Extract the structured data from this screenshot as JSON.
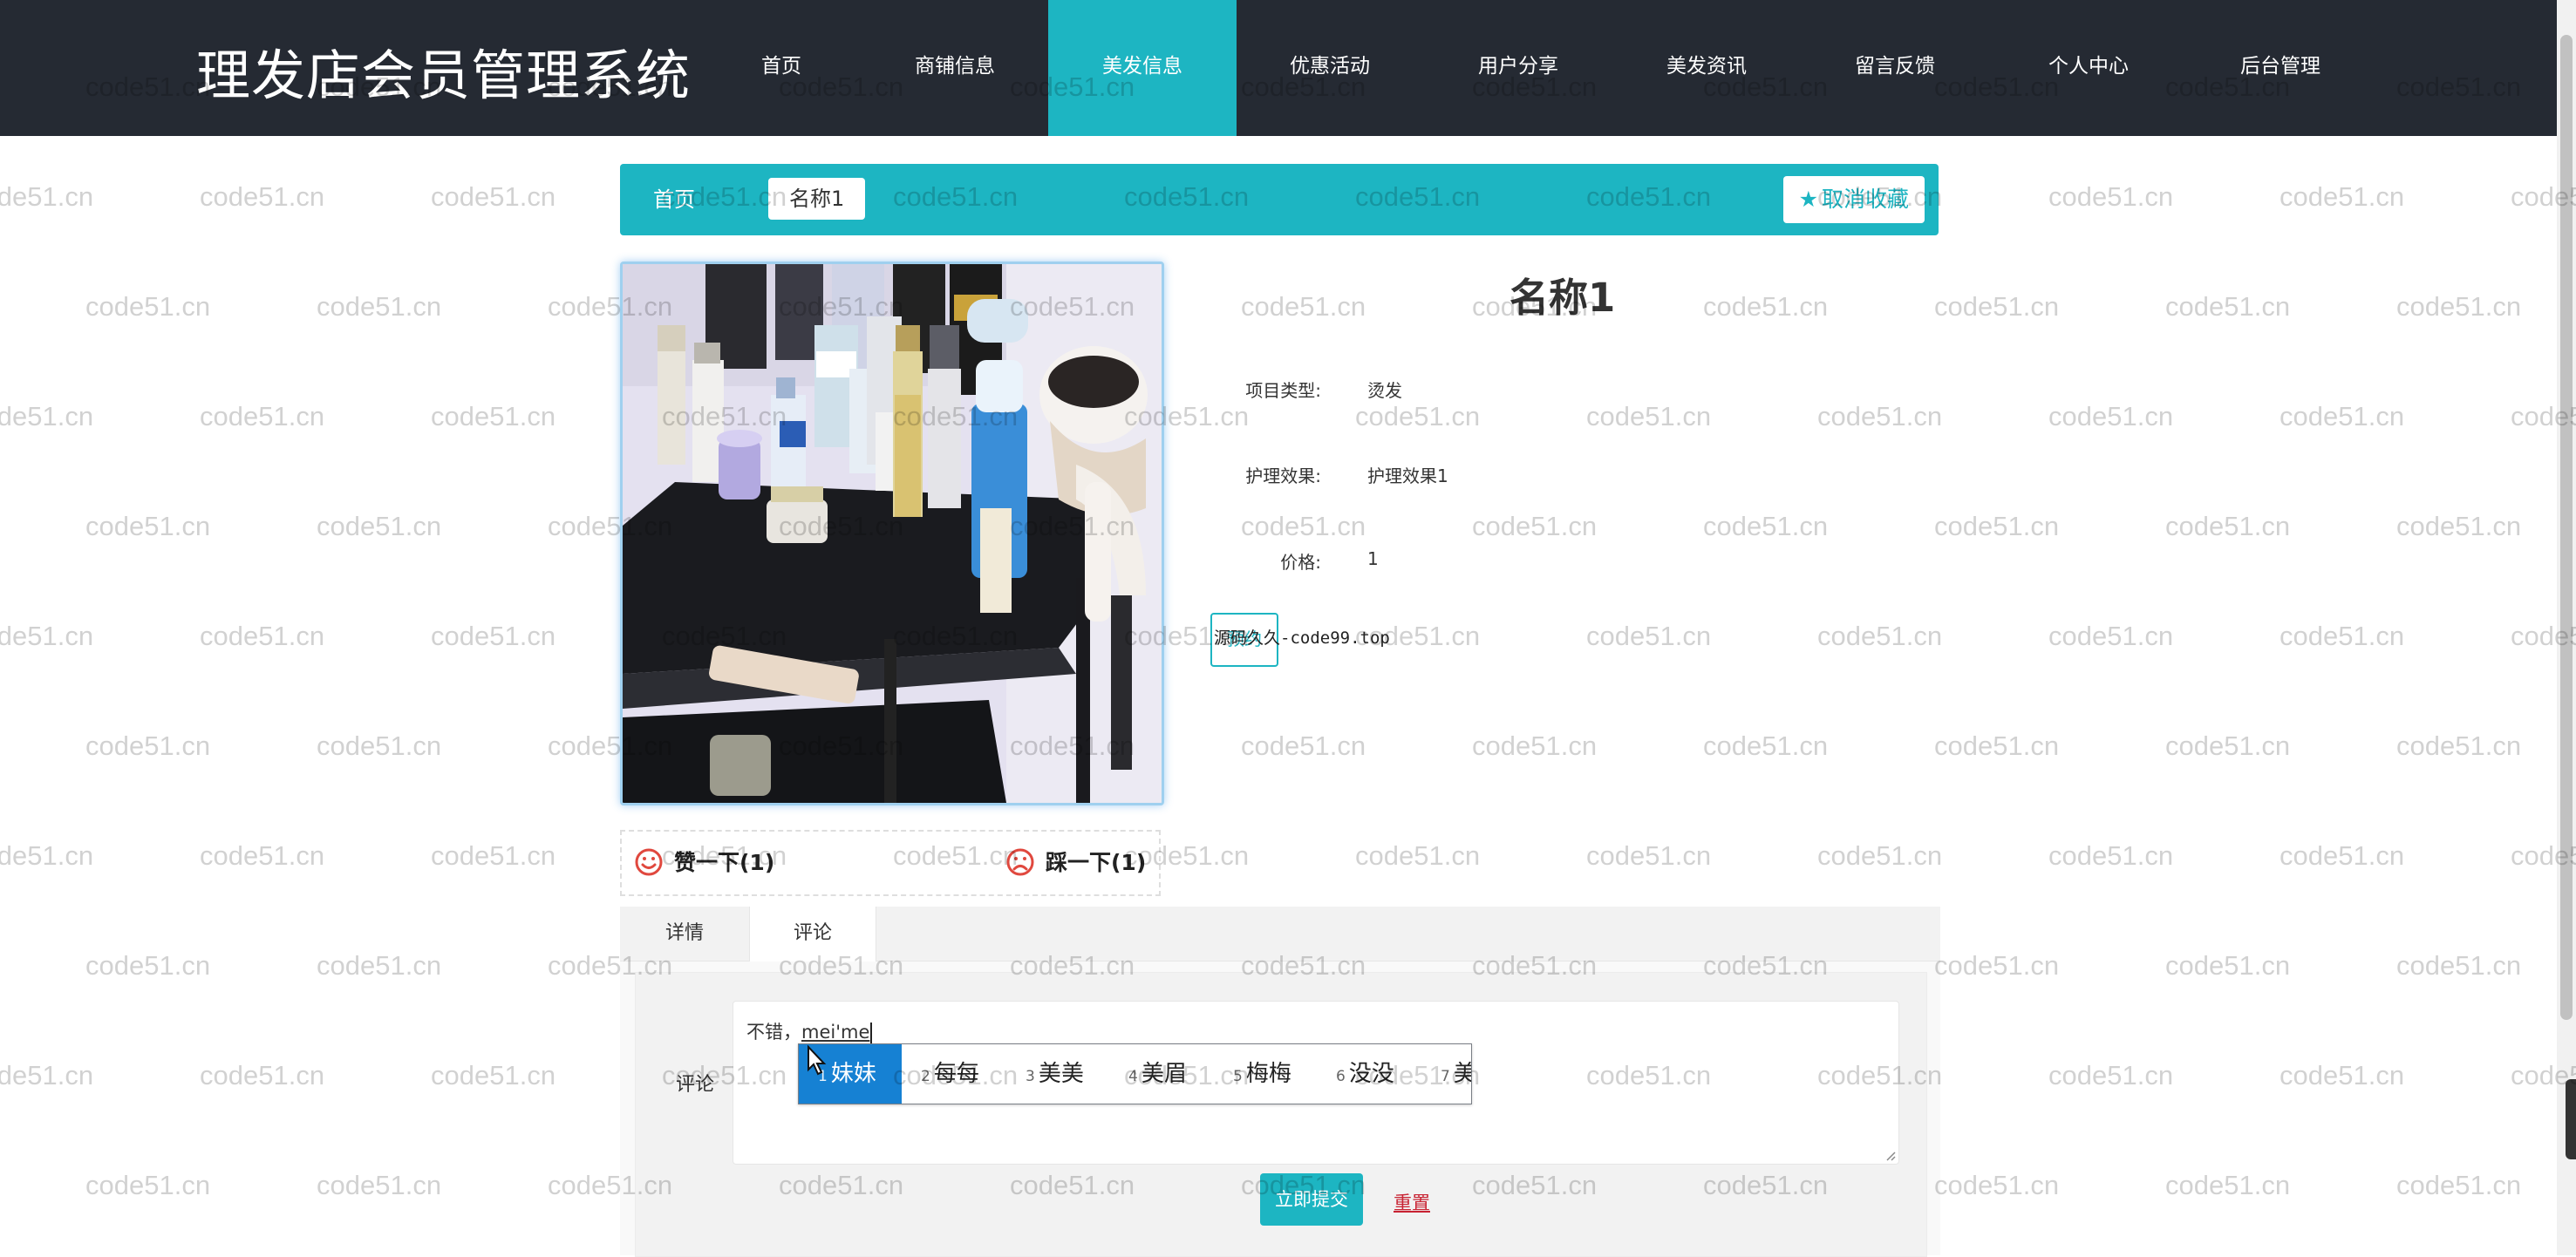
{
  "header": {
    "site_title": "理发店会员管理系统",
    "nav": [
      {
        "label": "首页",
        "active": false
      },
      {
        "label": "商铺信息",
        "active": false
      },
      {
        "label": "美发信息",
        "active": true
      },
      {
        "label": "优惠活动",
        "active": false
      },
      {
        "label": "用户分享",
        "active": false
      },
      {
        "label": "美发资讯",
        "active": false
      },
      {
        "label": "留言反馈",
        "active": false
      },
      {
        "label": "个人中心",
        "active": false
      },
      {
        "label": "后台管理",
        "active": false
      }
    ]
  },
  "breadcrumb": {
    "home": "首页",
    "current": "名称1",
    "favorite_label": "取消收藏"
  },
  "detail": {
    "title": "名称1",
    "fields": [
      {
        "label": "项目类型:",
        "value": "烫发"
      },
      {
        "label": "护理效果:",
        "value": "护理效果1"
      },
      {
        "label": "价格:",
        "value": "1"
      }
    ],
    "tag_label": "预约",
    "source_text": "源码久久-code99.top"
  },
  "votes": {
    "like_label": "赞一下(1)",
    "dislike_label": "踩一下(1)"
  },
  "tabs": [
    {
      "label": "详情",
      "active": false
    },
    {
      "label": "评论",
      "active": true
    }
  ],
  "comment_form": {
    "label": "评论",
    "text_committed": "不错，",
    "text_composing": "mei'me",
    "submit_label": "立即提交",
    "reset_label": "重置"
  },
  "ime": {
    "candidates": [
      {
        "num": "1",
        "text": "妹妹",
        "selected": true
      },
      {
        "num": "2",
        "text": "每每",
        "selected": false
      },
      {
        "num": "3",
        "text": "美美",
        "selected": false
      },
      {
        "num": "4",
        "text": "美眉",
        "selected": false
      },
      {
        "num": "5",
        "text": "梅梅",
        "selected": false
      },
      {
        "num": "6",
        "text": "没没",
        "selected": false
      },
      {
        "num": "7",
        "text": "美",
        "selected": false
      }
    ]
  },
  "watermark": "code51.cn",
  "colors": {
    "header_bg": "#252a33",
    "accent": "#1db5c2",
    "ime_highlight": "#1681d3",
    "reset_red": "#c82333"
  }
}
